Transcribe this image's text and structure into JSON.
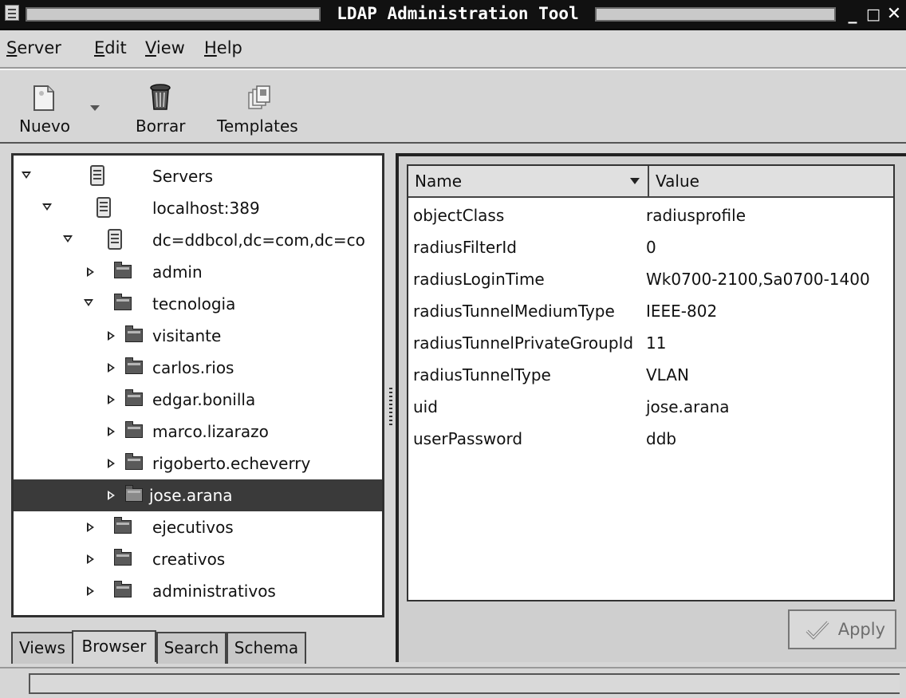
{
  "window": {
    "title": "LDAP Administration Tool",
    "controls": {
      "minimize": "_",
      "maximize": "□",
      "close": "✕"
    }
  },
  "menubar": {
    "items": [
      {
        "label": "erver",
        "mnemonic": "S"
      },
      {
        "label": "dit",
        "mnemonic": "E"
      },
      {
        "label": "iew",
        "mnemonic": "V"
      },
      {
        "label": "elp",
        "mnemonic": "H"
      }
    ]
  },
  "toolbar": {
    "buttons": [
      {
        "label": "Nuevo",
        "icon": "new-document-icon"
      },
      {
        "label": "Borrar",
        "icon": "trash-icon"
      },
      {
        "label": "Templates",
        "icon": "templates-icon"
      }
    ]
  },
  "tree": {
    "rows": [
      {
        "label": "Servers",
        "expander": "expanded",
        "icon": "server-icon"
      },
      {
        "label": "localhost:389",
        "expander": "expanded",
        "icon": "server-icon"
      },
      {
        "label": "dc=ddbcol,dc=com,dc=co",
        "expander": "expanded",
        "icon": "server-icon"
      },
      {
        "label": "admin",
        "expander": "collapsed",
        "icon": "folder-icon"
      },
      {
        "label": "tecnologia",
        "expander": "expanded",
        "icon": "folder-icon"
      },
      {
        "label": "visitante",
        "expander": "collapsed",
        "icon": "folder-icon"
      },
      {
        "label": "carlos.rios",
        "expander": "collapsed",
        "icon": "folder-icon"
      },
      {
        "label": "edgar.bonilla",
        "expander": "collapsed",
        "icon": "folder-icon"
      },
      {
        "label": "marco.lizarazo",
        "expander": "collapsed",
        "icon": "folder-icon"
      },
      {
        "label": "rigoberto.echeverry",
        "expander": "collapsed",
        "icon": "folder-icon"
      },
      {
        "label": "jose.arana",
        "expander": "collapsed",
        "icon": "folder-icon",
        "selected": true
      },
      {
        "label": "ejecutivos",
        "expander": "collapsed",
        "icon": "folder-icon"
      },
      {
        "label": "creativos",
        "expander": "collapsed",
        "icon": "folder-icon"
      },
      {
        "label": "administrativos",
        "expander": "collapsed",
        "icon": "folder-icon"
      }
    ]
  },
  "tabs": [
    "Views",
    "Browser",
    "Search",
    "Schema"
  ],
  "active_tab": "Browser",
  "properties": {
    "columns": {
      "name": "Name",
      "value": "Value"
    },
    "rows": [
      {
        "name": "objectClass",
        "value": "radiusprofile"
      },
      {
        "name": "radiusFilterId",
        "value": "0"
      },
      {
        "name": "radiusLoginTime",
        "value": "Wk0700-2100,Sa0700-1400"
      },
      {
        "name": "radiusTunnelMediumType",
        "value": "IEEE-802"
      },
      {
        "name": "radiusTunnelPrivateGroupId",
        "value": "11"
      },
      {
        "name": "radiusTunnelType",
        "value": "VLAN"
      },
      {
        "name": "uid",
        "value": "jose.arana"
      },
      {
        "name": "userPassword",
        "value": "ddb"
      }
    ]
  },
  "apply_button": {
    "label": "Apply",
    "enabled": false
  },
  "colors": {
    "selection": "#3a3a3a",
    "titlebar": "#111111",
    "background": "#d6d6d6"
  }
}
